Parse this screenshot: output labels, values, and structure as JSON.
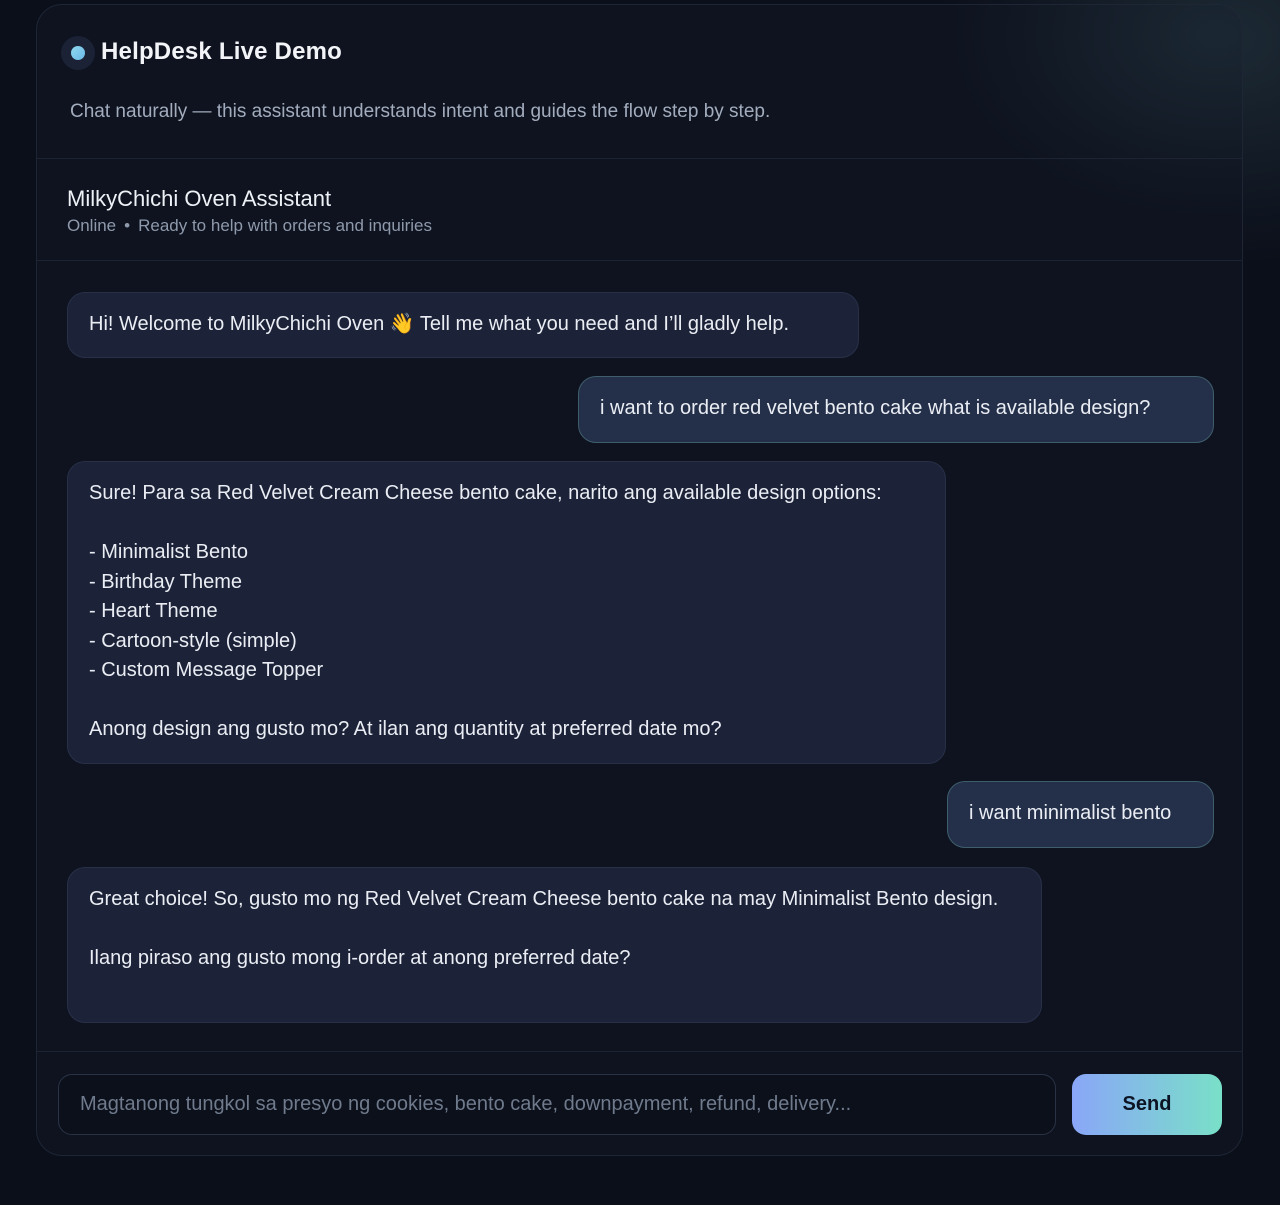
{
  "header": {
    "title": "HelpDesk Live Demo",
    "subtitle": "Chat naturally — this assistant understands intent and guides the flow step by step.",
    "logo_icon": "status-dot-icon"
  },
  "assistant": {
    "name": "MilkyChichi Oven Assistant",
    "status": "Online",
    "separator": "•",
    "tagline": "Ready to help with orders and inquiries"
  },
  "messages": [
    {
      "role": "assistant",
      "text": "Hi! Welcome to MilkyChichi Oven 👋 Tell me what you need and I’ll gladly help."
    },
    {
      "role": "user",
      "text": "i want to order red velvet bento cake what is available design?"
    },
    {
      "role": "assistant",
      "text": "Sure! Para sa Red Velvet Cream Cheese bento cake, narito ang available design options:\n\n- Minimalist Bento\n- Birthday Theme\n- Heart Theme\n- Cartoon-style (simple)\n- Custom Message Topper\n\nAnong design ang gusto mo? At ilan ang quantity at preferred date mo?"
    },
    {
      "role": "user",
      "text": "i want minimalist bento"
    },
    {
      "role": "assistant",
      "text": "Great choice! So, gusto mo ng Red Velvet Cream Cheese bento cake na may Minimalist Bento design.\n\nIlang piraso ang gusto mong i-order at anong preferred date?"
    }
  ],
  "composer": {
    "placeholder": "Magtanong tungkol sa presyo ng cookies, bento cake, downpayment, refund, delivery...",
    "value": "",
    "send_label": "Send"
  },
  "colors": {
    "background": "#0b0f1a",
    "panel": "#0e131f",
    "bot_bubble": "#1c2238",
    "user_bubble": "#24304a",
    "user_bubble_border": "#3f5e6c",
    "send_gradient_start": "#8aa6f8",
    "send_gradient_end": "#79e0c8"
  }
}
